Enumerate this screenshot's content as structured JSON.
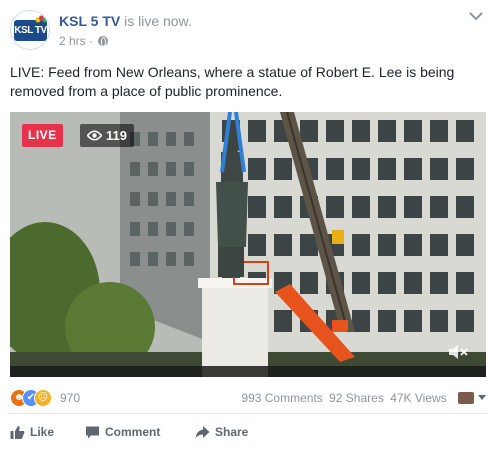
{
  "post": {
    "page_name": "KSL 5 TV",
    "live_suffix": " is live now.",
    "logo_text": "KSL TV",
    "time": "2 hrs",
    "separator": " · ",
    "privacy_icon": "globe-icon",
    "more_icon": "chevron-down-icon",
    "text": "LIVE: Feed from New Orleans, where a statue of Robert E. Lee is being removed from a place of public prominence."
  },
  "video": {
    "live_label": "LIVE",
    "viewer_count": "119",
    "viewer_icon": "eye-icon",
    "mute_icon": "speaker-muted-icon"
  },
  "stats": {
    "reaction_icons": [
      "angry-icon",
      "like-icon",
      "sad-icon"
    ],
    "reaction_count": "970",
    "comments": "993 Comments",
    "shares": "92 Shares",
    "views": "47K Views"
  },
  "actions": {
    "like": "Like",
    "comment": "Comment",
    "share": "Share"
  },
  "colors": {
    "link_blue": "#365899",
    "live_red": "#e4334a",
    "muted_text": "#90949c",
    "action_text": "#606770"
  }
}
